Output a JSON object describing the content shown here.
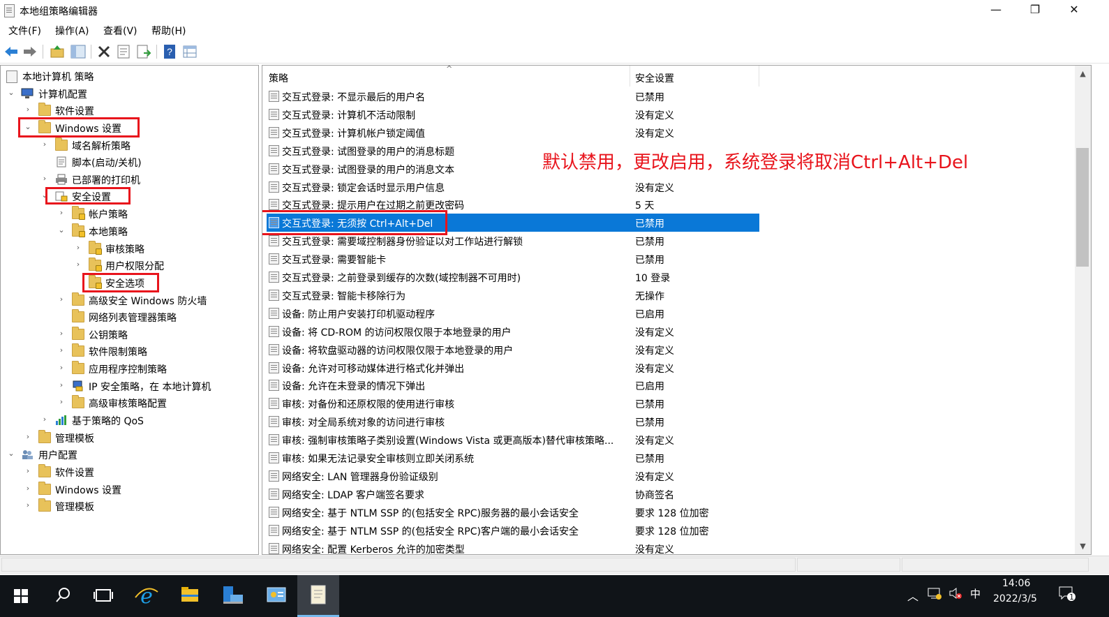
{
  "window": {
    "title": "本地组策略编辑器",
    "minimize": "—",
    "restore": "❐",
    "close": "✕"
  },
  "menu": [
    "文件(F)",
    "操作(A)",
    "查看(V)",
    "帮助(H)"
  ],
  "toolbar": {
    "buttons": [
      "back-icon",
      "forward-icon",
      "up-folder-icon",
      "show-hide-tree-icon",
      "delete-icon",
      "properties-icon",
      "export-list-icon",
      "help-icon",
      "view-icon"
    ]
  },
  "tree": {
    "root": "本地计算机 策略",
    "computer_config": "计算机配置",
    "software_settings": "软件设置",
    "windows_settings": "Windows 设置",
    "name_resolution": "域名解析策略",
    "scripts": "脚本(启动/关机)",
    "deployed_printers": "已部署的打印机",
    "security_settings": "安全设置",
    "account_policies": "帐户策略",
    "local_policies": "本地策略",
    "audit_policy": "审核策略",
    "user_rights": "用户权限分配",
    "security_options": "安全选项",
    "firewall": "高级安全 Windows 防火墙",
    "network_list": "网络列表管理器策略",
    "public_key": "公钥策略",
    "software_restriction": "软件限制策略",
    "app_control": "应用程序控制策略",
    "ipsec": "IP 安全策略，在 本地计算机",
    "advanced_audit": "高级审核策略配置",
    "qos": "基于策略的 QoS",
    "admin_templates": "管理模板",
    "user_config": "用户配置",
    "user_software": "软件设置",
    "user_windows": "Windows 设置",
    "user_admin_templates": "管理模板"
  },
  "list": {
    "col_policy": "策略",
    "col_setting": "安全设置",
    "rows": [
      {
        "name": "交互式登录: 不显示最后的用户名",
        "value": "已禁用"
      },
      {
        "name": "交互式登录: 计算机不活动限制",
        "value": "没有定义"
      },
      {
        "name": "交互式登录: 计算机帐户锁定阈值",
        "value": "没有定义"
      },
      {
        "name": "交互式登录: 试图登录的用户的消息标题",
        "value": ""
      },
      {
        "name": "交互式登录: 试图登录的用户的消息文本",
        "value": ""
      },
      {
        "name": "交互式登录: 锁定会话时显示用户信息",
        "value": "没有定义"
      },
      {
        "name": "交互式登录: 提示用户在过期之前更改密码",
        "value": "5 天"
      },
      {
        "name": "交互式登录: 无须按 Ctrl+Alt+Del",
        "value": "已禁用"
      },
      {
        "name": "交互式登录: 需要域控制器身份验证以对工作站进行解锁",
        "value": "已禁用"
      },
      {
        "name": "交互式登录: 需要智能卡",
        "value": "已禁用"
      },
      {
        "name": "交互式登录: 之前登录到缓存的次数(域控制器不可用时)",
        "value": "10 登录"
      },
      {
        "name": "交互式登录: 智能卡移除行为",
        "value": "无操作"
      },
      {
        "name": "设备: 防止用户安装打印机驱动程序",
        "value": "已启用"
      },
      {
        "name": "设备: 将 CD-ROM 的访问权限仅限于本地登录的用户",
        "value": "没有定义"
      },
      {
        "name": "设备: 将软盘驱动器的访问权限仅限于本地登录的用户",
        "value": "没有定义"
      },
      {
        "name": "设备: 允许对可移动媒体进行格式化并弹出",
        "value": "没有定义"
      },
      {
        "name": "设备: 允许在未登录的情况下弹出",
        "value": "已启用"
      },
      {
        "name": "审核: 对备份和还原权限的使用进行审核",
        "value": "已禁用"
      },
      {
        "name": "审核: 对全局系统对象的访问进行审核",
        "value": "已禁用"
      },
      {
        "name": "审核: 强制审核策略子类别设置(Windows Vista 或更高版本)替代审核策略...",
        "value": "没有定义"
      },
      {
        "name": "审核: 如果无法记录安全审核则立即关闭系统",
        "value": "已禁用"
      },
      {
        "name": "网络安全: LAN 管理器身份验证级别",
        "value": "没有定义"
      },
      {
        "name": "网络安全: LDAP 客户端签名要求",
        "value": "协商签名"
      },
      {
        "name": "网络安全: 基于 NTLM SSP 的(包括安全 RPC)服务器的最小会话安全",
        "value": "要求 128 位加密"
      },
      {
        "name": "网络安全: 基于 NTLM SSP 的(包括安全 RPC)客户端的最小会话安全",
        "value": "要求 128 位加密"
      },
      {
        "name": "网络安全: 配置 Kerberos 允许的加密类型",
        "value": "没有定义"
      }
    ],
    "selected_index": 7
  },
  "annotation": "默认禁用，更改启用，系统登录将取消Ctrl+Alt+Del",
  "taskbar": {
    "time": "14:06",
    "date": "2022/3/5",
    "ime": "中",
    "notification_count": "1"
  },
  "colors": {
    "selection": "#0a78d7",
    "annotation": "#e8141c"
  }
}
